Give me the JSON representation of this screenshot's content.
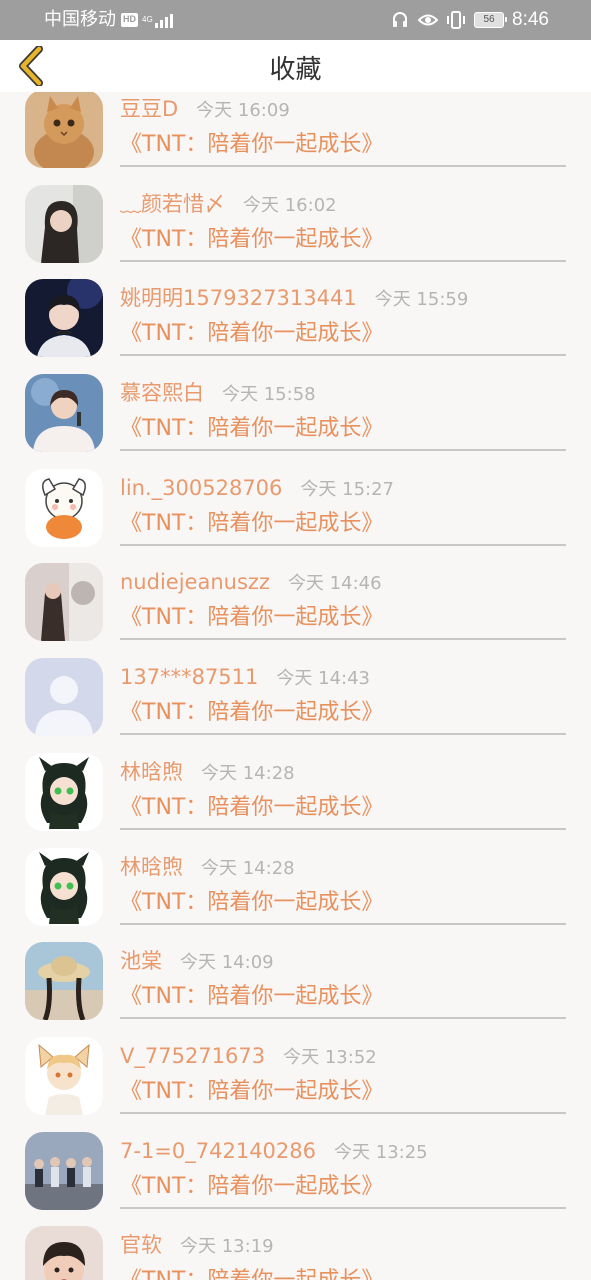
{
  "status_bar": {
    "carrier": "中国移动",
    "hd": "HD",
    "network": "4G",
    "battery": "56",
    "time": "8:46"
  },
  "header": {
    "title": "收藏",
    "back_icon": "chevron-left-icon"
  },
  "colors": {
    "accent": "#e8915d",
    "nickname": "#e89a6d",
    "timestamp": "#b5b5b5",
    "status_bar": "#9e9e9e",
    "back_icon": "#e8b42a"
  },
  "favorites": [
    {
      "name": "豆豆D",
      "time": "今天 16:09",
      "title": "《TNT：陪着你一起成长》",
      "avatar": "cat-photo"
    },
    {
      "name": "﹏颜若惜〆",
      "time": "今天 16:02",
      "title": "《TNT：陪着你一起成长》",
      "avatar": "girl-photo"
    },
    {
      "name": "姚明明1579327313441",
      "time": "今天 15:59",
      "title": "《TNT：陪着你一起成长》",
      "avatar": "singer-photo"
    },
    {
      "name": "慕容熙白",
      "time": "今天 15:58",
      "title": "《TNT：陪着你一起成长》",
      "avatar": "performer-photo"
    },
    {
      "name": "lin._300528706",
      "time": "今天 15:27",
      "title": "《TNT：陪着你一起成长》",
      "avatar": "cartoon-character"
    },
    {
      "name": "nudiejeanuszz",
      "time": "今天 14:46",
      "title": "《TNT：陪着你一起成长》",
      "avatar": "mirror-photo"
    },
    {
      "name": "137***87511",
      "time": "今天 14:43",
      "title": "《TNT：陪着你一起成长》",
      "avatar": "default-user"
    },
    {
      "name": "林晗煦",
      "time": "今天 14:28",
      "title": "《TNT：陪着你一起成长》",
      "avatar": "anime-character"
    },
    {
      "name": "林晗煦",
      "time": "今天 14:28",
      "title": "《TNT：陪着你一起成长》",
      "avatar": "anime-character"
    },
    {
      "name": "池棠",
      "time": "今天 14:09",
      "title": "《TNT：陪着你一起成长》",
      "avatar": "straw-hat-photo"
    },
    {
      "name": "V_775271673",
      "time": "今天 13:52",
      "title": "《TNT：陪着你一起成长》",
      "avatar": "anime-fox-character"
    },
    {
      "name": "7-1=0_742140286",
      "time": "今天 13:25",
      "title": "《TNT：陪着你一起成长》",
      "avatar": "group-photo"
    },
    {
      "name": "官软",
      "time": "今天 13:19",
      "title": "《TNT：陪着你一起成长》",
      "avatar": "boy-photo"
    }
  ]
}
